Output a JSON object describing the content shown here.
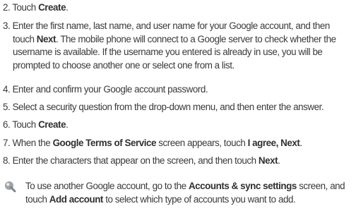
{
  "steps": [
    {
      "num": "2.",
      "t1": "Touch",
      "b1": "Create",
      "t2": "."
    },
    {
      "num": "3.",
      "line1": "Enter the first name, last name, and user name for your Google account, and then",
      "t_touch": "touch",
      "b_next": "Next",
      "line2_rest": ". The mobile phone will connect to a Google server to check whether the",
      "line3": "username is available. If the username you entered is already in use, you will be",
      "line4": "prompted to choose another one or select one from a list."
    },
    {
      "num": "4.",
      "text": "Enter and confirm your Google account password."
    },
    {
      "num": "5.",
      "text": "Select a security question from the drop-down menu, and then enter the answer."
    },
    {
      "num": "6.",
      "t1": "Touch",
      "b1": "Create",
      "t2": "."
    },
    {
      "num": "7.",
      "t1": "When the",
      "b1": "Google Terms of Service",
      "t2": "screen appears, touch",
      "b2": "I agree, Next",
      "t3": "."
    },
    {
      "num": "8.",
      "t1": "Enter the characters that appear on the screen, and then touch",
      "b1": "Next",
      "t2": "."
    }
  ],
  "note": {
    "icon": "note-tip-icon",
    "t1": "To use another Google account, go to the",
    "b1": "Accounts & sync settings",
    "t2": "screen,",
    "t3": "and touch",
    "b2": "Add account",
    "t4": "to select which type of accounts you want to add."
  }
}
